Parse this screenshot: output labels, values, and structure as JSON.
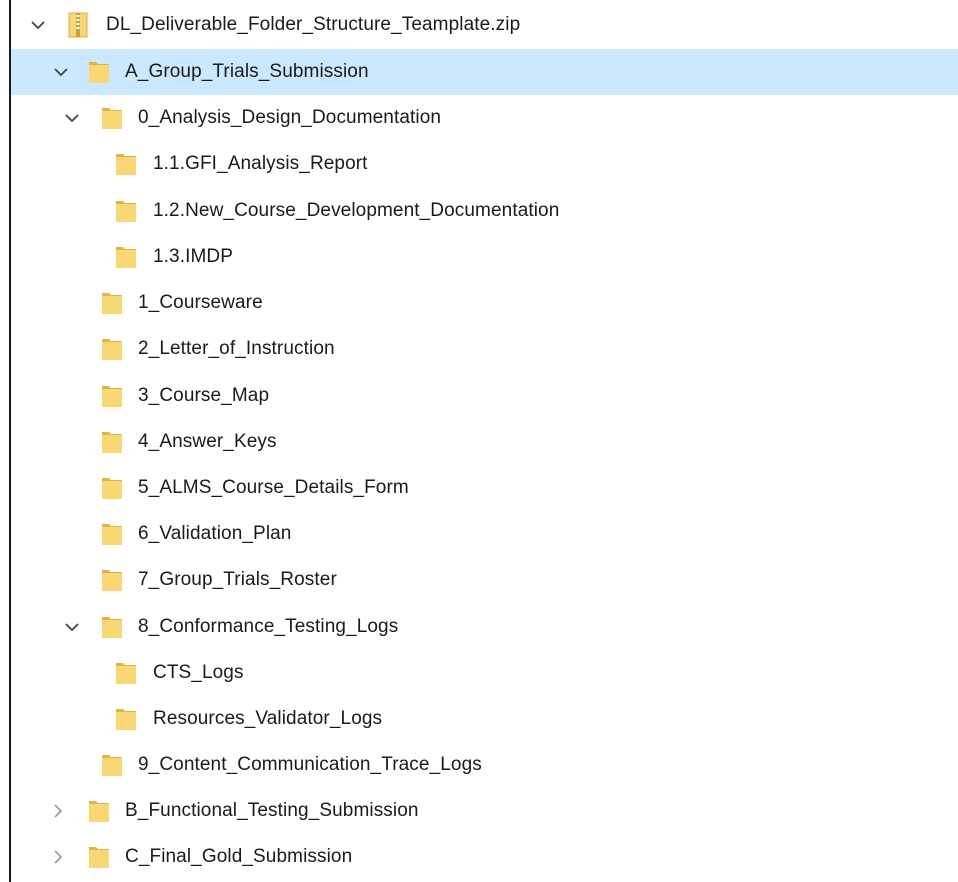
{
  "tree": {
    "root": {
      "label": "DL_Deliverable_Folder_Structure_Teamplate.zip",
      "icon": "zip-folder-icon",
      "expanded": true
    },
    "items": [
      {
        "label": "A_Group_Trials_Submission",
        "icon": "folder-icon",
        "expanded": true,
        "selected": true
      },
      {
        "label": "0_Analysis_Design_Documentation",
        "icon": "folder-icon",
        "expanded": true
      },
      {
        "label": "1.1.GFI_Analysis_Report",
        "icon": "folder-icon"
      },
      {
        "label": "1.2.New_Course_Development_Documentation",
        "icon": "folder-icon"
      },
      {
        "label": "1.3.IMDP",
        "icon": "folder-icon"
      },
      {
        "label": "1_Courseware",
        "icon": "folder-icon"
      },
      {
        "label": "2_Letter_of_Instruction",
        "icon": "folder-icon"
      },
      {
        "label": "3_Course_Map",
        "icon": "folder-icon"
      },
      {
        "label": "4_Answer_Keys",
        "icon": "folder-icon"
      },
      {
        "label": "5_ALMS_Course_Details_Form",
        "icon": "folder-icon"
      },
      {
        "label": "6_Validation_Plan",
        "icon": "folder-icon"
      },
      {
        "label": "7_Group_Trials_Roster",
        "icon": "folder-icon"
      },
      {
        "label": "8_Conformance_Testing_Logs",
        "icon": "folder-icon",
        "expanded": true
      },
      {
        "label": "CTS_Logs",
        "icon": "folder-icon"
      },
      {
        "label": "Resources_Validator_Logs",
        "icon": "folder-icon"
      },
      {
        "label": "9_Content_Communication_Trace_Logs",
        "icon": "folder-icon"
      },
      {
        "label": "B_Functional_Testing_Submission",
        "icon": "folder-icon",
        "expanded": false
      },
      {
        "label": "C_Final_Gold_Submission",
        "icon": "folder-icon",
        "expanded": false
      }
    ]
  },
  "colors": {
    "selection": "#cce8ff",
    "folder_body": "#f8d775",
    "folder_back": "#e0b44a",
    "text": "#1a1a1a",
    "chevron": "#444444"
  }
}
